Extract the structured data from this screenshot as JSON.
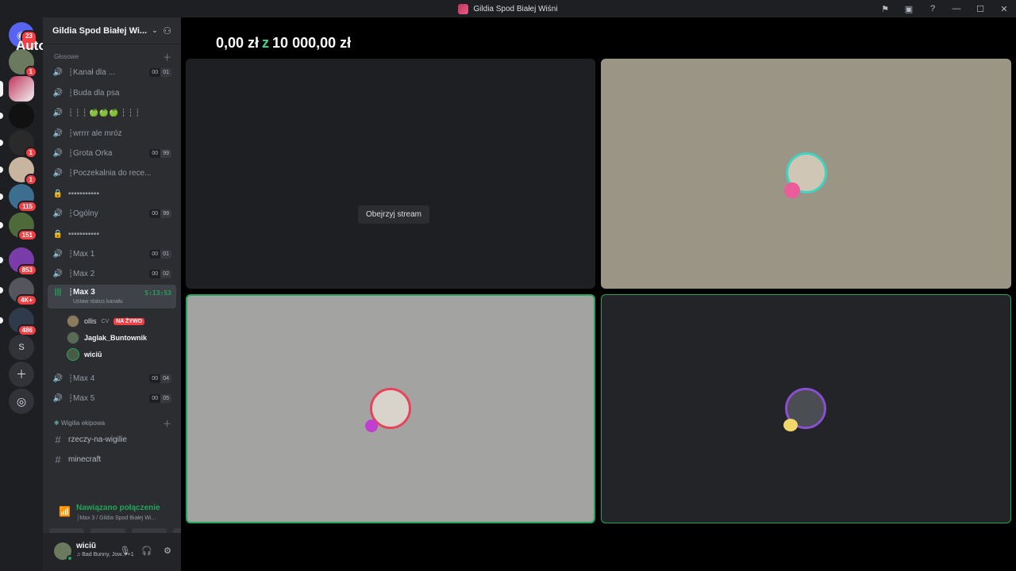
{
  "window": {
    "title": "Gildia Spod Białej Wiśni"
  },
  "rail": {
    "auto_label": "Auto",
    "badges": [
      "23",
      "1",
      "1",
      "1",
      "115",
      "151",
      "853",
      "4K+",
      "486"
    ],
    "dm_badge": "1",
    "s_label": "S"
  },
  "sidebar": {
    "guild_name": "Gildia Spod Białej Wi...",
    "category_voice": "Głosowe",
    "channels": [
      {
        "icon": "speaker",
        "name": "┆Kanał dla ...",
        "count": [
          "00",
          "01"
        ]
      },
      {
        "icon": "speaker",
        "name": "┆Buda dla psa",
        "count": null
      },
      {
        "icon": "speaker-lock",
        "name": "┆ ┆ ┆ 🍏🍏🍏 ┆ ┆ ┆",
        "count": null
      },
      {
        "icon": "speaker-lock",
        "name": "┆wrrrr ale mróz",
        "count": null
      },
      {
        "icon": "speaker-lock",
        "name": "┆Grota Orka",
        "count": [
          "00",
          "99"
        ]
      },
      {
        "icon": "speaker",
        "name": "┆Poczekalnia do rece...",
        "count": null
      },
      {
        "icon": "lock",
        "name": "▪▪▪▪▪▪▪▪▪▪▪",
        "count": null
      },
      {
        "icon": "speaker",
        "name": "┆Ogólny",
        "count": [
          "00",
          "99"
        ]
      },
      {
        "icon": "lock",
        "name": "▪▪▪▪▪▪▪▪▪▪▪",
        "count": null
      },
      {
        "icon": "speaker",
        "name": "┆Max 1",
        "count": [
          "00",
          "01"
        ]
      },
      {
        "icon": "speaker",
        "name": "┆Max 2",
        "count": [
          "00",
          "02"
        ]
      }
    ],
    "active_channel": {
      "name": "┆Max 3",
      "timer": "5:13:53",
      "status": "Ustaw status kanału"
    },
    "members": [
      {
        "name": "ollis",
        "tag": "CV",
        "live": "NA ŻYWO"
      },
      {
        "name": "Jaglak_Buntownik"
      },
      {
        "name": "wiciū"
      }
    ],
    "channels_after": [
      {
        "icon": "speaker",
        "name": "┆Max 4",
        "count": [
          "00",
          "04"
        ]
      },
      {
        "icon": "speaker",
        "name": "┆Max 5",
        "count": [
          "00",
          "05"
        ]
      }
    ],
    "category_wigilia": "Wigilia ekipowa",
    "text_channels": [
      {
        "name": "rzeczy-na-wigilie"
      },
      {
        "name": "minecraft"
      }
    ]
  },
  "voice_panel": {
    "status": "Nawiązano połączenie",
    "sub": "┆Max 3 / Gildia Spod Białej Wi..."
  },
  "user": {
    "name": "wiciū",
    "song": "Bad Bunny, Jow...",
    "extra": "+1"
  },
  "stage": {
    "money_left": "0,00 zł",
    "money_sep": "z",
    "money_right": "10 000,00 zł",
    "watch_stream": "Obejrzyj stream"
  },
  "colors": {
    "accent_green": "#23a55a",
    "badge_red": "#f23f43",
    "tile_dark": "#232428",
    "tile_beige": "#9b9585",
    "tile_gray": "#a3a3a1"
  }
}
